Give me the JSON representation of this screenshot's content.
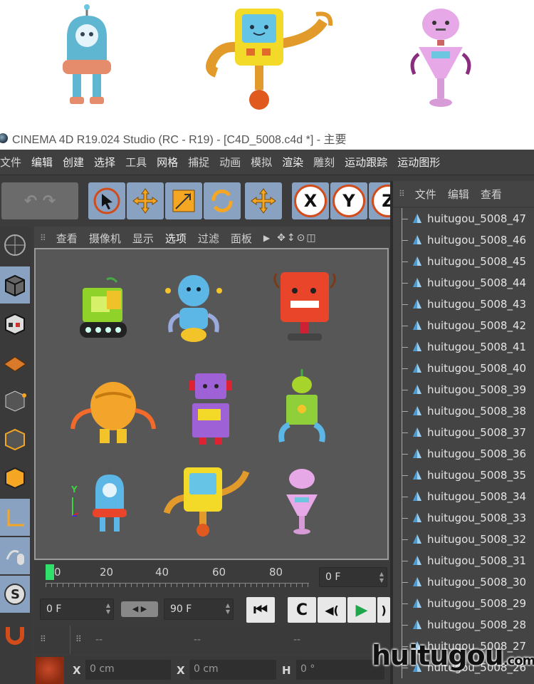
{
  "title_bar": {
    "text": "CINEMA 4D R19.024 Studio (RC - R19) - [C4D_5008.c4d *] - 主要"
  },
  "menubar": {
    "items": [
      "文件",
      "编辑",
      "创建",
      "选择",
      "工具",
      "网格",
      "捕捉",
      "动画",
      "模拟",
      "渲染",
      "雕刻",
      "运动跟踪",
      "运动图形"
    ]
  },
  "viewport": {
    "menu": [
      "查看",
      "摄像机",
      "显示",
      "选项",
      "过滤",
      "面板"
    ],
    "axis_label": "Y"
  },
  "toolbar": {
    "axis_x": "X",
    "axis_y": "Y",
    "axis_z": "Z"
  },
  "timeline": {
    "ticks": [
      "0",
      "20",
      "40",
      "60",
      "80"
    ],
    "current_frame": "0 F"
  },
  "transport": {
    "start_frame": "0 F",
    "end_frame": "90 F"
  },
  "coords": {
    "header_dashes": [
      "--",
      "--",
      "--"
    ],
    "x_label": "X",
    "x_value": "0 cm",
    "x2_label": "X",
    "x2_value": "0 cm",
    "h_label": "H",
    "h_value": "0 °"
  },
  "object_manager": {
    "menu": [
      "文件",
      "编辑",
      "查看"
    ],
    "objects": [
      "huitugou_5008_47",
      "huitugou_5008_46",
      "huitugou_5008_45",
      "huitugou_5008_44",
      "huitugou_5008_43",
      "huitugou_5008_42",
      "huitugou_5008_41",
      "huitugou_5008_40",
      "huitugou_5008_39",
      "huitugou_5008_38",
      "huitugou_5008_37",
      "huitugou_5008_36",
      "huitugou_5008_35",
      "huitugou_5008_34",
      "huitugou_5008_33",
      "huitugou_5008_32",
      "huitugou_5008_31",
      "huitugou_5008_30",
      "huitugou_5008_29",
      "huitugou_5008_28",
      "huitugou_5008_27",
      "huitugou_5008_26"
    ]
  },
  "watermark": {
    "main": "huitugou",
    "suffix": ".com"
  },
  "colors": {
    "accent_blue": "#8aa2c2",
    "axis_red": "#d24b1a",
    "panel": "#444444"
  }
}
